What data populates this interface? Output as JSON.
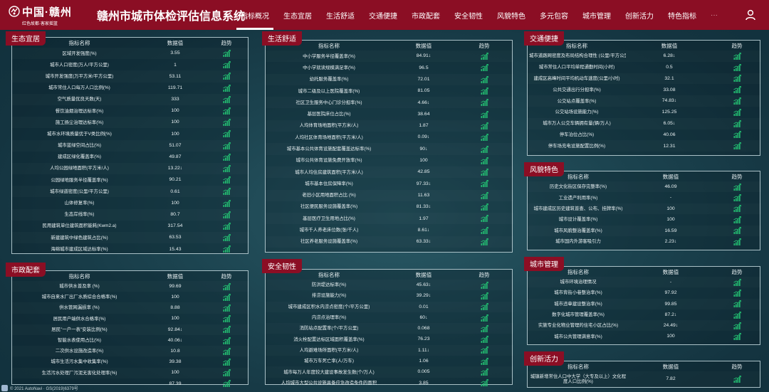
{
  "header": {
    "logo_name": "中国·赣州",
    "logo_slogan": "红色故都·客家摇篮",
    "title": "赣州市城市体检评估信息系统"
  },
  "nav": [
    "指标概况",
    "生态宜居",
    "生活舒适",
    "交通便捷",
    "市政配套",
    "安全韧性",
    "风貌特色",
    "多元包容",
    "城市管理",
    "创新活力",
    "特色指标",
    "···"
  ],
  "table_header": {
    "name": "指标名称",
    "value": "数据值",
    "trend": "趋势"
  },
  "footer": "© 2021 AutoNavi · GS(2019)6379号",
  "colors": {
    "brand": "#8b0e24",
    "trend": "#23c273"
  },
  "panels": {
    "eco": {
      "title": "生态宜居",
      "rows": [
        [
          "区域开发强度(%)",
          "3.55"
        ],
        [
          "城市人口密度(万人/平方公里)",
          "1"
        ],
        [
          "城市开发强度(万平方米/平方公里)",
          "53.11"
        ],
        [
          "城市常住人口每万人口比例(%)",
          "119.71"
        ],
        [
          "空气质量优良天数(天)",
          "333"
        ],
        [
          "餐饮油烟治理达标率(%)",
          "100"
        ],
        [
          "施工扬尘治理达标率(%)",
          "100"
        ],
        [
          "城市水环境质量优于V类比例(%)",
          "100"
        ],
        [
          "城市蓝绿空间占比(%)",
          "51.07"
        ],
        [
          "建成区绿化覆盖率(%)",
          "49.87"
        ],
        [
          "人均公园绿地面积(平方米/人)",
          "13.22↓"
        ],
        [
          "公园绿地服务半径覆盖率(%)",
          "90.21"
        ],
        [
          "城市绿道密度(公里/平方公里)",
          "0.61"
        ],
        [
          "山体修复率(%)",
          "100"
        ],
        [
          "生态岸线率(%)",
          "80.7"
        ],
        [
          "民用建筑单位建筑面积能耗(Kwm2.a)",
          "317.54"
        ],
        [
          "新建建筑中绿色建筑占比(%)",
          "63.53"
        ],
        [
          "海绵城市建成区域达标率(%)",
          "15.43"
        ]
      ]
    },
    "life": {
      "title": "生活舒适",
      "rows": [
        [
          "中小学服务半径覆盖率(%)",
          "84.91↓"
        ],
        [
          "中小学就读规模满足率(%)",
          "96.5"
        ],
        [
          "幼托服务覆盖率(%)",
          "72.01"
        ],
        [
          "城市二级及以上医院覆盖率(%)",
          "81.05"
        ],
        [
          "社区卫生服务中心门诊分担率(%)",
          "4.66↓"
        ],
        [
          "基层医院床位占比(%)",
          "38.64"
        ],
        [
          "人均体育场地面积(平方米/人)",
          "1.87"
        ],
        [
          "人均社区体育场地面积(平方米/人)",
          "0.09↓"
        ],
        [
          "城市基本公共体育设施配套覆盖达标率(%)",
          "90↓"
        ],
        [
          "城市公共体育设施免费开放率(%)",
          "100"
        ],
        [
          "城市人均住房建筑面积(平方米/人)",
          "42.85"
        ],
        [
          "城市基本住房保障率(%)",
          "97.33↓"
        ],
        [
          "老旧小区用地面积占比 (%)",
          "11.63"
        ],
        [
          "社区便民服务设施覆盖率(%)",
          "81.33↓"
        ],
        [
          "基层医疗卫生用地占比(%)",
          "1.97"
        ],
        [
          "城市千人养老床位数(张/千人)",
          "8.61↓"
        ],
        [
          "社区养老服务设施覆盖率(%)",
          "63.33↓"
        ]
      ]
    },
    "traffic": {
      "title": "交通便捷",
      "rows": [
        [
          "城市道路网密度及布局结构合理性 (公里/平方公里)",
          "6.28↓"
        ],
        [
          "城市常住人口平均单程通勤时间(小时)",
          "0.5"
        ],
        [
          "建成区高峰时间平均机动车速度(公里/小时)",
          "32.1"
        ],
        [
          "公共交通出行分担率(%)",
          "33.08"
        ],
        [
          "公交站点覆盖率(%)",
          "74.83↓"
        ],
        [
          "公交站场设施能力(%)",
          "125.25"
        ],
        [
          "城市万人公交车辆拥有量(辆/万人)",
          "6.05↓"
        ],
        [
          "停车泊位占比(%)",
          "40.06"
        ],
        [
          "停车场充电设施配置比例(%)",
          "12.31"
        ]
      ]
    },
    "style": {
      "title": "风貌特色",
      "rows": [
        [
          "历史文化街区保存完整率(%)",
          "46.09"
        ],
        [
          "工业遗产利用率(%)",
          "-"
        ],
        [
          "城市建成区历史建筑普查、公布、挂牌率(%)",
          "100"
        ],
        [
          "城市设计覆盖率(%)",
          "100"
        ],
        [
          "城市风貌整治覆盖率(%)",
          "16.59"
        ],
        [
          "城市国内外游客吸引力",
          "2.23↓"
        ]
      ]
    },
    "muni": {
      "title": "市政配套",
      "rows": [
        [
          "城市供水普及率 (%)",
          "99.69"
        ],
        [
          "城市自来水厂出厂水质综合合格率(%)",
          "100"
        ],
        [
          "供水管网漏损率 (%)",
          "8.88"
        ],
        [
          "居民用户端供水合格率(%)",
          "100"
        ],
        [
          "居民\"一户一表\"安装比例(%)",
          "92.84↓"
        ],
        [
          "智能水表使用占比(%)",
          "40.06↓"
        ],
        [
          "二次供水设施改造率(%)",
          "10.8"
        ],
        [
          "城市生活污水集中收集率(%)",
          "39.38"
        ],
        [
          "生活污水处理厂污泥无害化处理率(%)",
          "100"
        ],
        [
          "",
          "87.39"
        ]
      ]
    },
    "safety": {
      "title": "安全韧性",
      "rows": [
        [
          "防洪堤达标率(%)",
          "45.63↓"
        ],
        [
          "排涝设施能力(%)",
          "39.29↓"
        ],
        [
          "城市建成区积水内涝点密度(个/平方公里)",
          "0.01"
        ],
        [
          "内涝点治理率(%)",
          "60↓"
        ],
        [
          "消防站点配置率(个/平方公里)",
          "0.068"
        ],
        [
          "消火栓配置达标区域面积覆盖率(%)",
          "76.23"
        ],
        [
          "人均避难场所面积(平方米/人)",
          "1.11↓"
        ],
        [
          "城市万车死亡率(人/万车)",
          "1.06"
        ],
        [
          "城市每万人年度较大建设事故发生数(个/万人)",
          "0.005"
        ],
        [
          "人均城市大型公共设施具备应急改造条件的面积",
          "3.85"
        ]
      ]
    },
    "manage": {
      "title": "城市管理",
      "rows": [
        [
          "城市环境治理情况",
          "-"
        ],
        [
          "城市背街小巷整治率(%)",
          "97.92"
        ],
        [
          "城市违章建设整治率(%)",
          "99.85"
        ],
        [
          "数字化城市管理覆盖率(%)",
          "87.2↓"
        ],
        [
          "实施专业化物业管理的住宅小区占比(%)",
          "24.49↓"
        ],
        [
          "城市公共管理满意率(%)",
          "100"
        ]
      ]
    },
    "innov": {
      "title": "创新活力",
      "rows": [
        [
          "城镇新增常住人口中大学（大专及以上）文化程度人口比例(%)",
          "7.82"
        ]
      ]
    }
  }
}
